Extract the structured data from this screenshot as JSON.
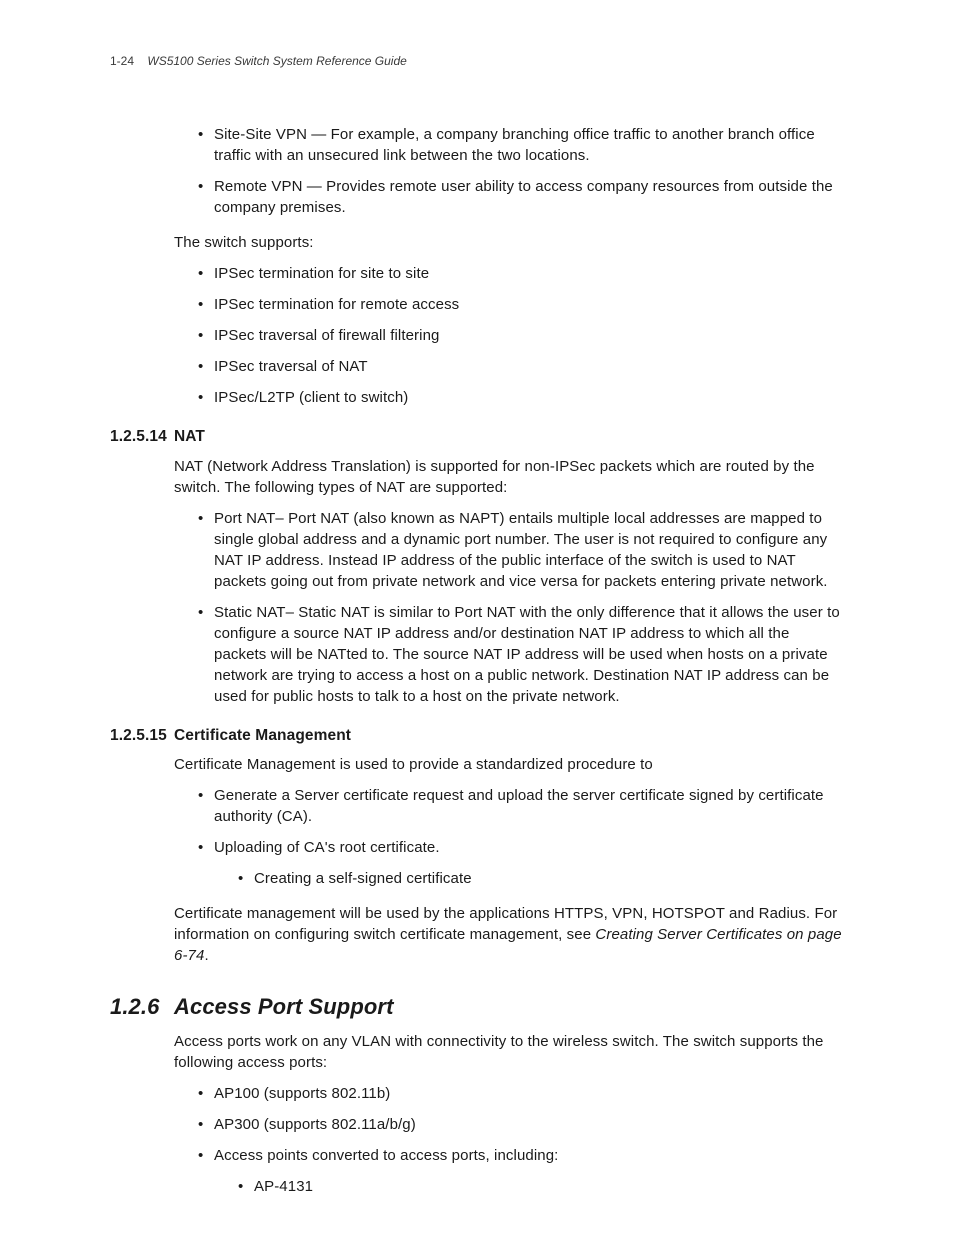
{
  "header": {
    "page_number": "1-24",
    "doc_title": "WS5100 Series Switch System Reference Guide"
  },
  "intro_bullets": [
    "Site-Site VPN — For example, a company branching office traffic to another branch office traffic with an unsecured link between the two locations.",
    "Remote VPN — Provides remote user ability to access company resources from outside the company premises."
  ],
  "switch_supports_label": "The switch supports:",
  "switch_supports": [
    "IPSec termination for site to site",
    "IPSec termination for remote access",
    "IPSec traversal of firewall filtering",
    "IPSec traversal of NAT",
    "IPSec/L2TP (client to switch)"
  ],
  "sec_nat": {
    "num": "1.2.5.14",
    "title": "NAT",
    "intro": "NAT (Network Address Translation) is supported for non-IPSec packets which are routed by the switch. The following types of NAT are supported:",
    "bullets": [
      "Port NAT– Port NAT (also known as NAPT) entails multiple local addresses are mapped to single global address and a dynamic port number. The user is not required to configure any NAT IP address. Instead IP address of the public interface of the switch is used to NAT packets going out from private network and vice versa for packets entering private network.",
      "Static NAT– Static NAT is similar to Port NAT with the only difference that it allows the user to configure a source NAT IP address and/or destination NAT IP address to which all the packets will be NATted to. The source NAT IP address will be used when hosts on a private network are trying to access a host on a public network. Destination NAT IP address can be used for public hosts to talk to a host on the private network."
    ]
  },
  "sec_cert": {
    "num": "1.2.5.15",
    "title": "Certificate Management",
    "intro": "Certificate Management is used to provide a standardized procedure to",
    "bullets": [
      "Generate a Server certificate request and upload the server certificate signed by certificate authority (CA).",
      "Uploading of CA's root certificate."
    ],
    "subbullet": "Creating a self-signed certificate",
    "outro_prefix": "Certificate management will be used by the applications HTTPS, VPN, HOTSPOT and Radius. For information on configuring switch certificate management, see  ",
    "outro_xref": "Creating Server Certificates on page 6-74",
    "outro_suffix": "."
  },
  "sec_access": {
    "num": "1.2.6",
    "title": "Access Port Support",
    "intro": "Access ports work on any VLAN with connectivity to the wireless switch. The switch supports the following access ports:",
    "bullets": [
      "AP100 (supports 802.11b)",
      "AP300 (supports 802.11a/b/g)",
      "Access points converted to access ports, including:"
    ],
    "subbullet": "AP-4131"
  }
}
